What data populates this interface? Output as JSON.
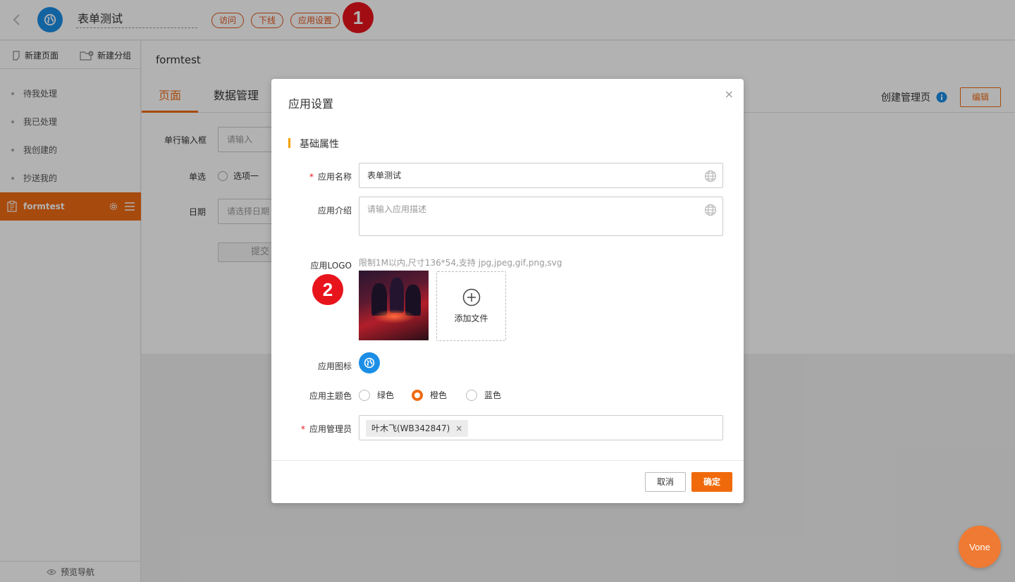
{
  "header": {
    "app_title": "表单测试",
    "visit_label": "访问",
    "offline_label": "下线",
    "settings_label": "应用设置",
    "badge_1": "1"
  },
  "sidebar": {
    "new_page": "新建页面",
    "new_group": "新建分组",
    "items": [
      {
        "label": "待我处理"
      },
      {
        "label": "我已处理"
      },
      {
        "label": "我创建的"
      },
      {
        "label": "抄送我的"
      },
      {
        "label": "formtest"
      }
    ],
    "preview_nav": "预览导航"
  },
  "main": {
    "title": "formtest",
    "tabs": [
      {
        "label": "页面"
      },
      {
        "label": "数据管理"
      }
    ],
    "create_admin": "创建管理页",
    "edit_label": "编辑",
    "form": {
      "single_line_label": "单行输入框",
      "single_line_placeholder": "请输入",
      "radio_label": "单选",
      "radio_option": "选项一",
      "date_label": "日期",
      "date_placeholder": "请选择日期",
      "submit_label": "提交"
    }
  },
  "modal": {
    "title": "应用设置",
    "close": "×",
    "section": "基础属性",
    "name_label": "应用名称",
    "name_value": "表单测试",
    "intro_label": "应用介绍",
    "intro_placeholder": "请输入应用描述",
    "logo_label": "应用LOGO",
    "logo_hint": "限制1M以内,尺寸136*54,支持 jpg,jpeg,gif,png,svg",
    "add_file": "添加文件",
    "icon_label": "应用图标",
    "theme_label": "应用主题色",
    "theme_options": [
      {
        "label": "绿色",
        "checked": false
      },
      {
        "label": "橙色",
        "checked": true
      },
      {
        "label": "蓝色",
        "checked": false
      }
    ],
    "admin_label": "应用管理员",
    "admin_tag": "叶木飞(WB342847)",
    "tag_remove": "×",
    "cancel_label": "取消",
    "ok_label": "确定",
    "badge_2": "2"
  },
  "vone": "Vone",
  "colors": {
    "accent": "#ef6a13",
    "brand_blue": "#1b8ee6",
    "badge_red": "#e8141c"
  }
}
